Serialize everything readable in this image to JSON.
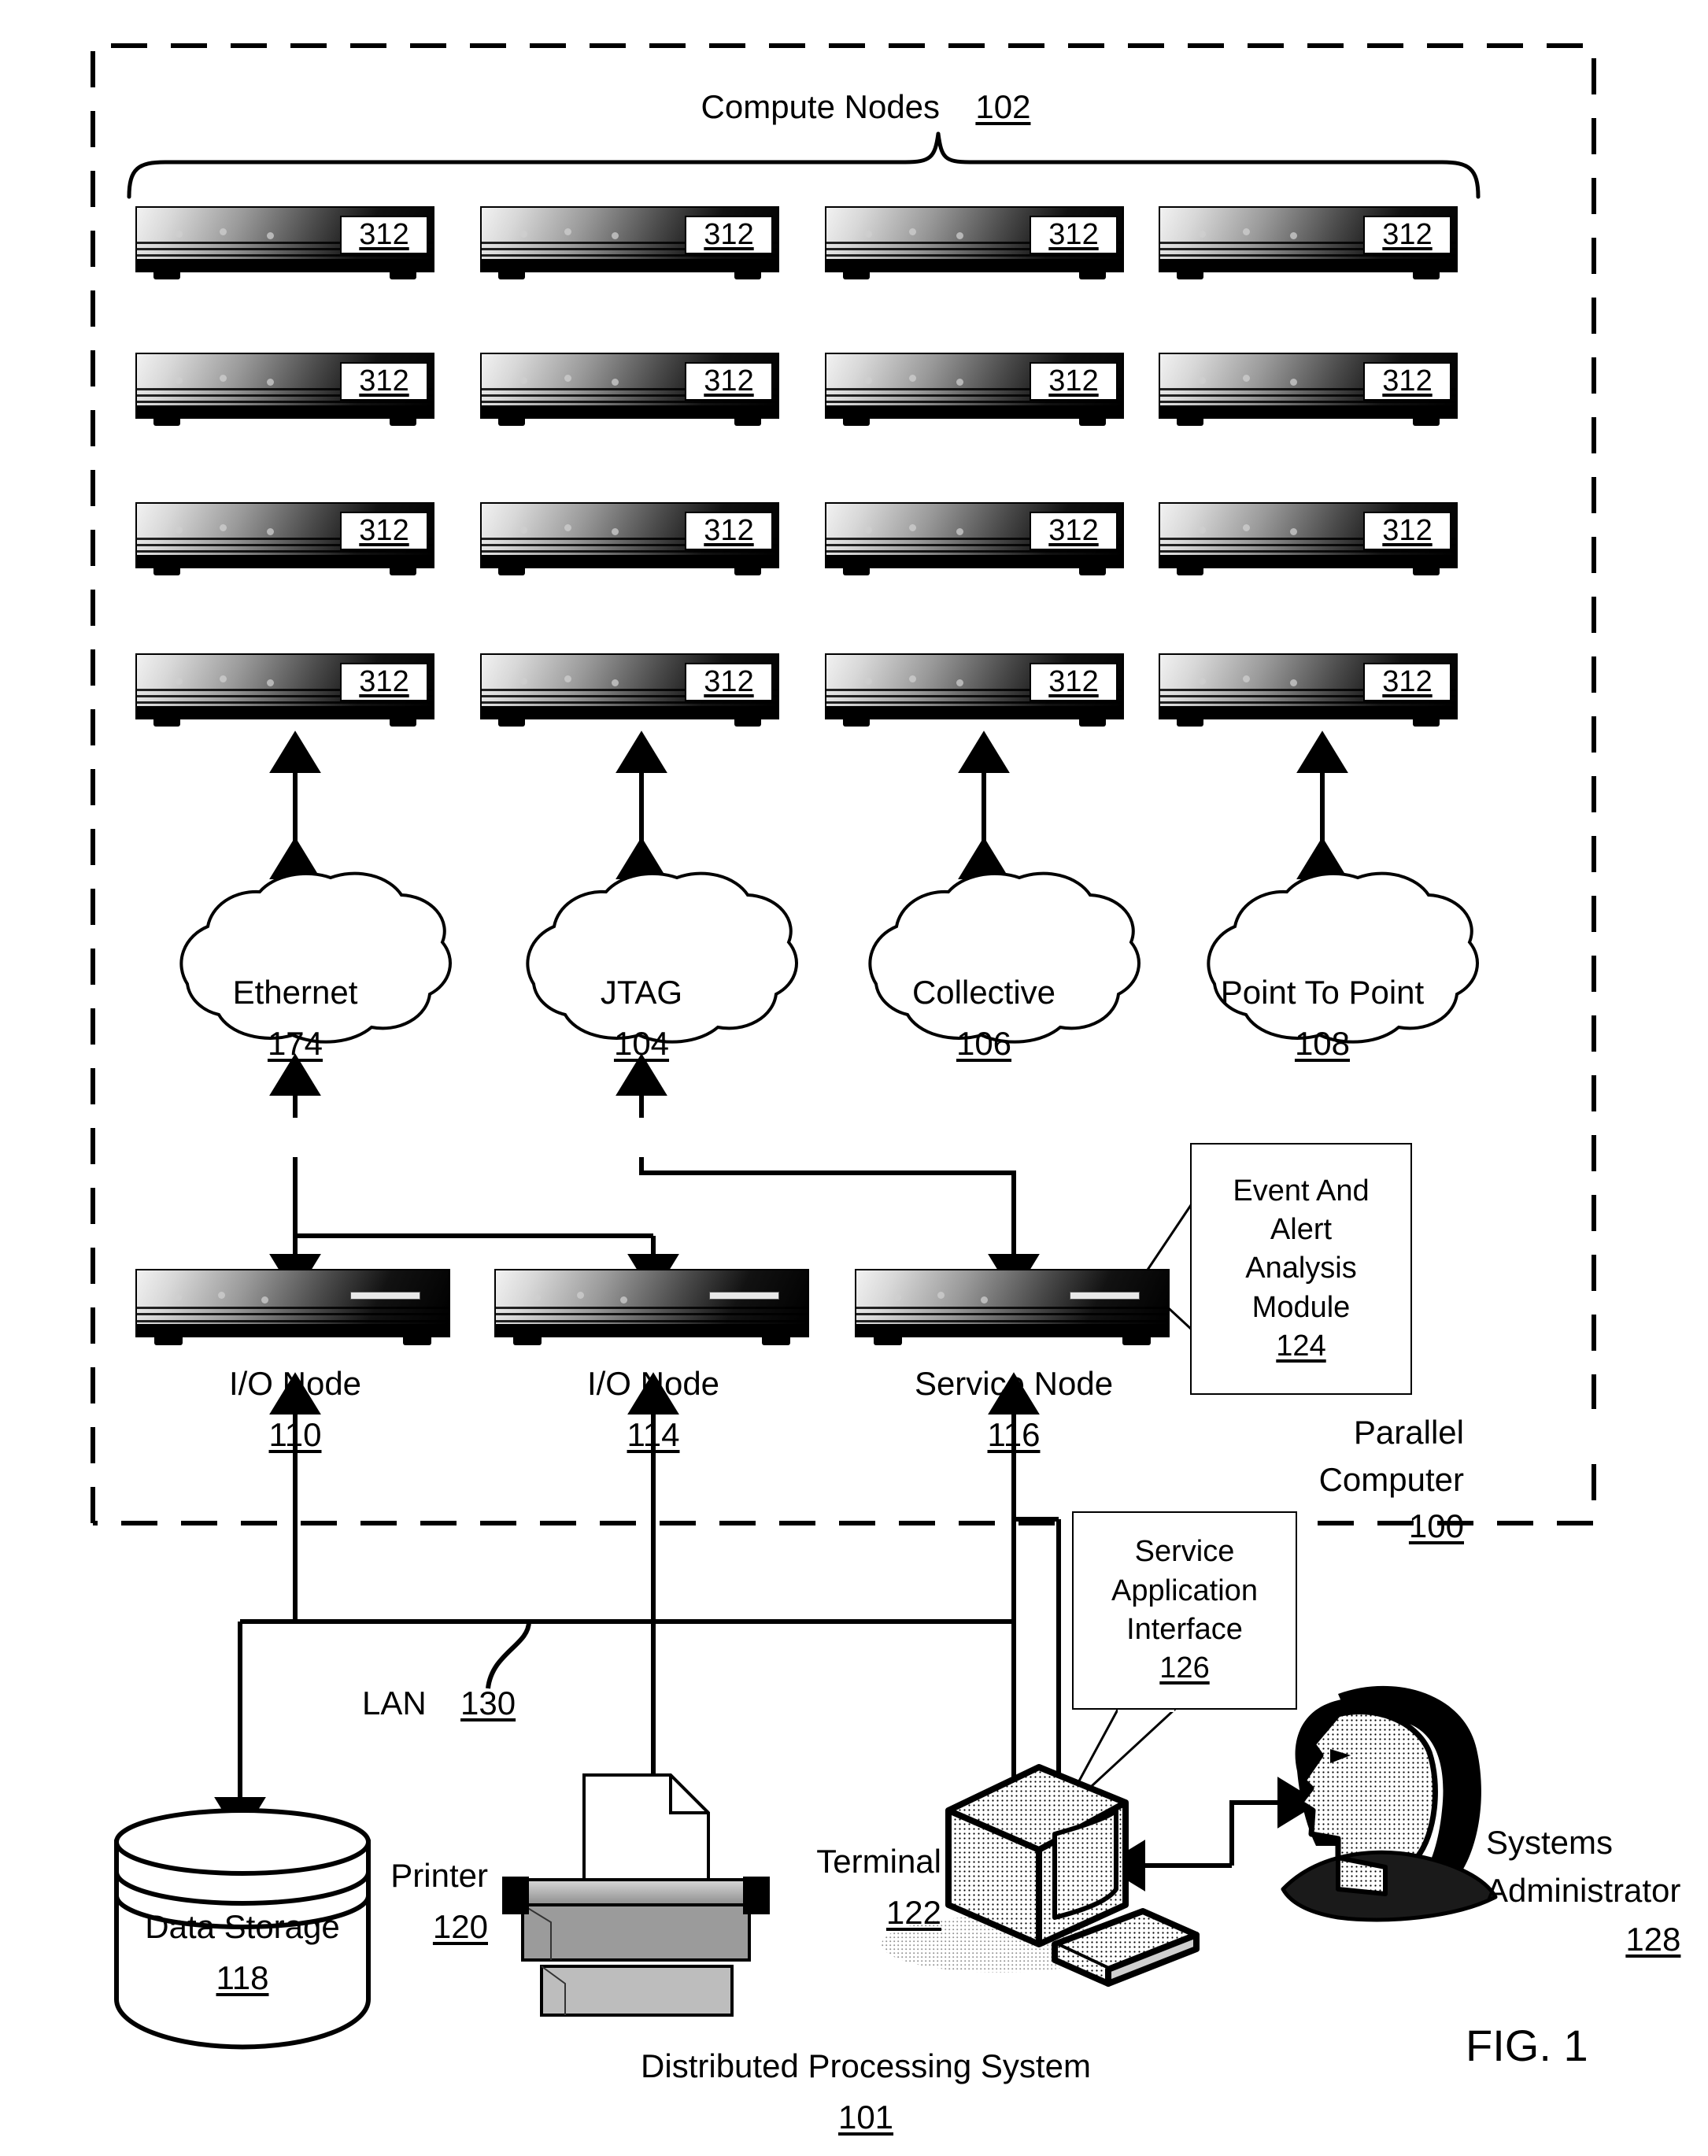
{
  "figure": {
    "label": "FIG. 1",
    "caption_title": "Distributed Processing System",
    "caption_ref": "101"
  },
  "parallel_computer": {
    "name_line1": "Parallel",
    "name_line2": "Computer",
    "ref": "100"
  },
  "compute_nodes": {
    "title": "Compute Nodes",
    "ref": "102",
    "node_ref": "312",
    "rows": 4,
    "cols": 4,
    "items": [
      {
        "ref": "312"
      },
      {
        "ref": "312"
      },
      {
        "ref": "312"
      },
      {
        "ref": "312"
      },
      {
        "ref": "312"
      },
      {
        "ref": "312"
      },
      {
        "ref": "312"
      },
      {
        "ref": "312"
      },
      {
        "ref": "312"
      },
      {
        "ref": "312"
      },
      {
        "ref": "312"
      },
      {
        "ref": "312"
      },
      {
        "ref": "312"
      },
      {
        "ref": "312"
      },
      {
        "ref": "312"
      },
      {
        "ref": "312"
      }
    ]
  },
  "networks": [
    {
      "name": "Ethernet",
      "ref": "174"
    },
    {
      "name": "JTAG",
      "ref": "104"
    },
    {
      "name": "Collective",
      "ref": "106"
    },
    {
      "name": "Point To Point",
      "ref": "108"
    }
  ],
  "service_nodes": [
    {
      "name": "I/O Node",
      "ref": "110"
    },
    {
      "name": "I/O Node",
      "ref": "114"
    },
    {
      "name": "Service Node",
      "ref": "116"
    }
  ],
  "event_alert_module": {
    "lines": [
      "Event And",
      "Alert",
      "Analysis",
      "Module"
    ],
    "ref": "124"
  },
  "service_application_interface": {
    "lines": [
      "Service",
      "Application",
      "Interface"
    ],
    "ref": "126"
  },
  "lan": {
    "name": "LAN",
    "ref": "130"
  },
  "peripherals": {
    "data_storage": {
      "name": "Data Storage",
      "ref": "118"
    },
    "printer": {
      "name": "Printer",
      "ref": "120"
    },
    "terminal": {
      "name": "Terminal",
      "ref": "122"
    },
    "administrator": {
      "line1": "Systems",
      "line2": "Administrator",
      "ref": "128"
    }
  },
  "colors": {
    "ink": "#000000",
    "paper": "#ffffff",
    "chassis_light": "#f2f2f2",
    "chassis_dark": "#000000",
    "screen_fill": "#e9e9e9",
    "printer_gray": "#b9b9b9"
  }
}
